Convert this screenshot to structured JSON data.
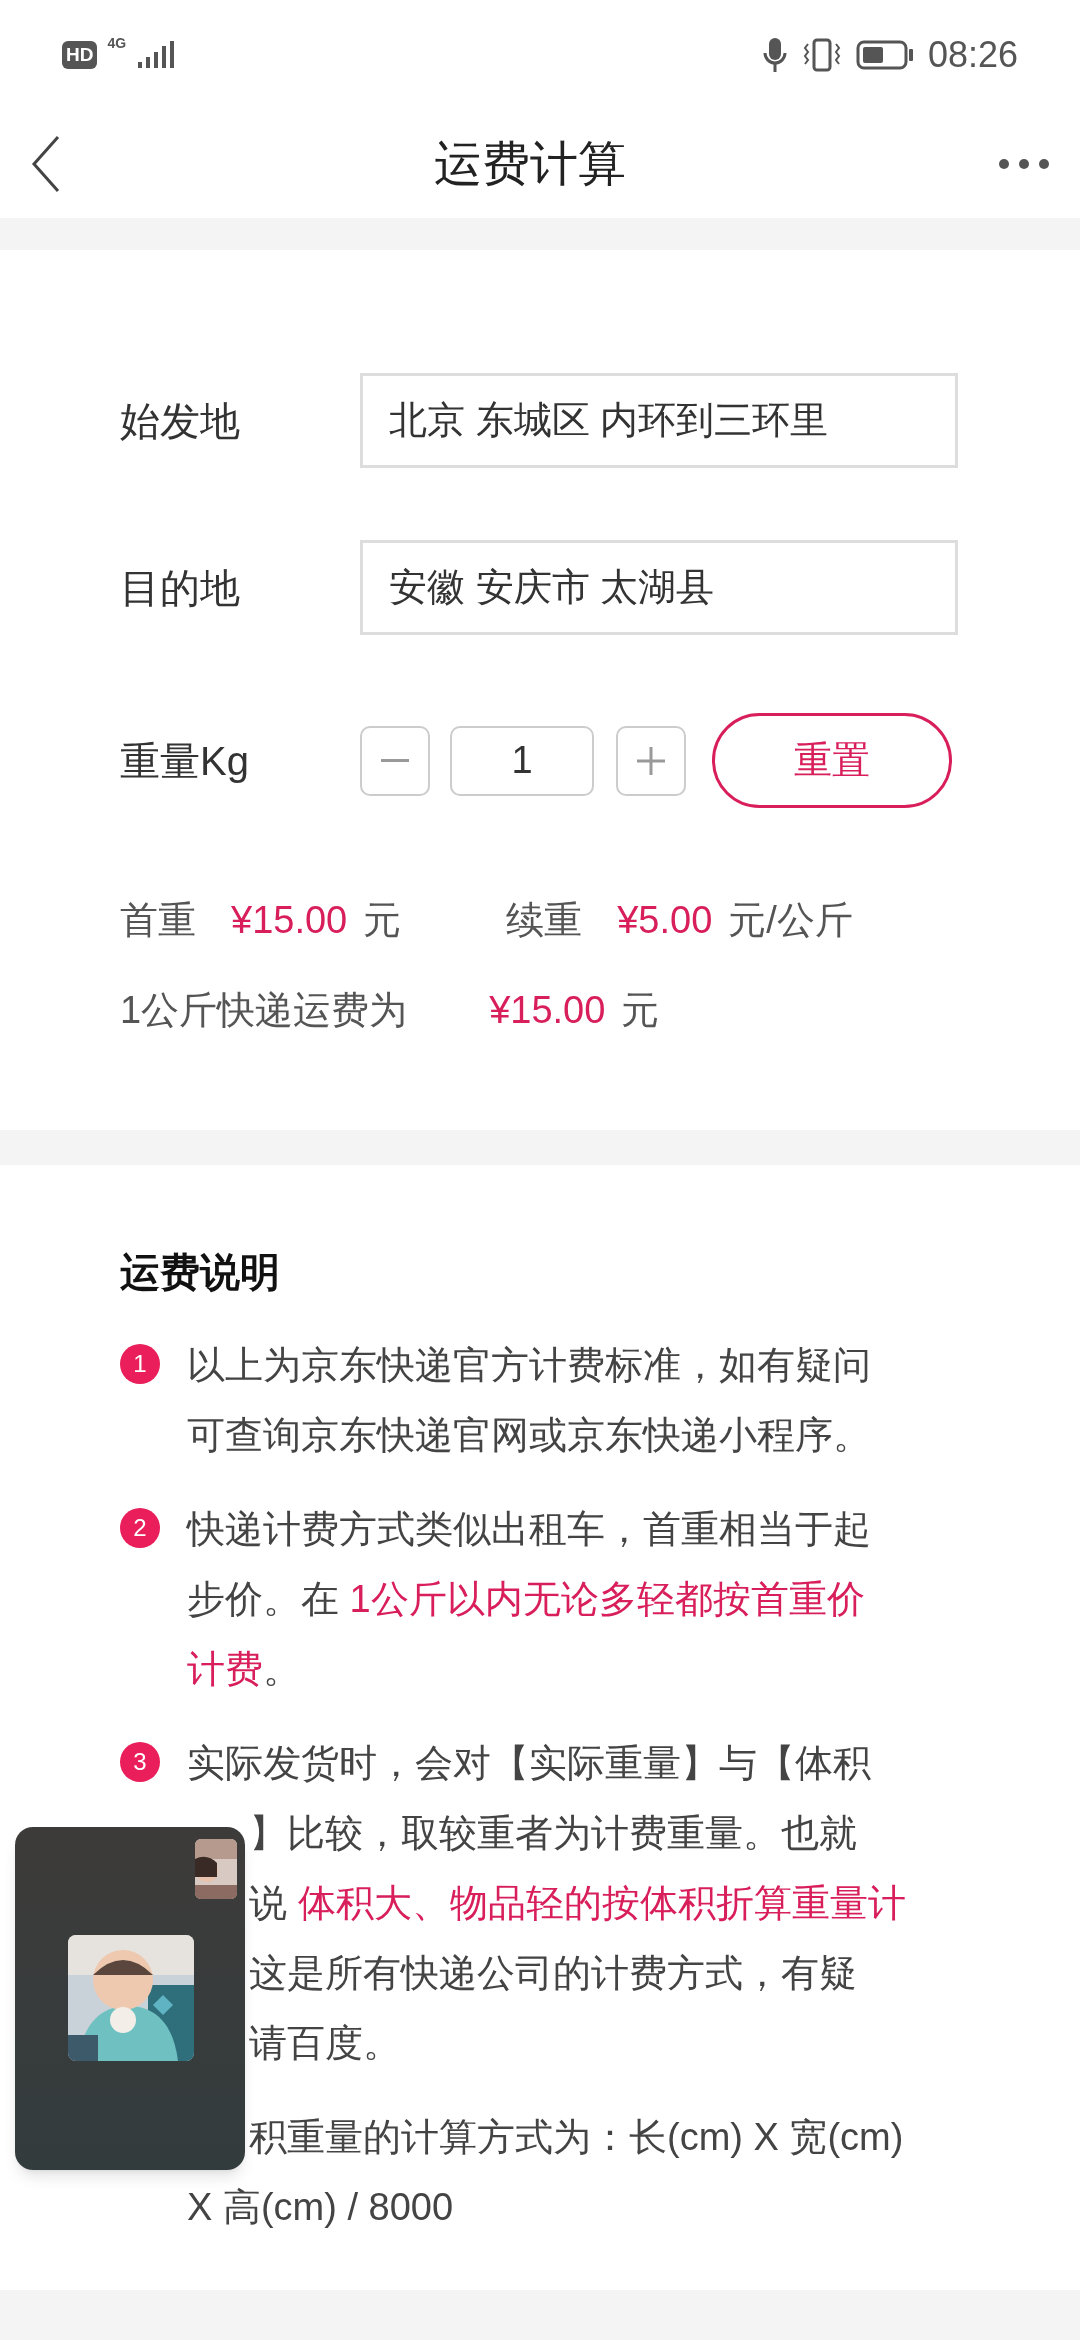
{
  "status_bar": {
    "hd": "HD",
    "network": "4G",
    "time": "08:26"
  },
  "nav": {
    "title": "运费计算"
  },
  "form": {
    "fields": [
      {
        "label": "始发地",
        "value": "北京 东城区 内环到三环里"
      },
      {
        "label": "目的地",
        "value": "安徽 安庆市 太湖县"
      }
    ],
    "weight": {
      "label": "重量Kg",
      "value": "1",
      "reset": "重置"
    },
    "prices": [
      [
        {
          "text": "首重",
          "highlight": false
        },
        {
          "text": "¥15.00",
          "highlight": true
        },
        {
          "text": "元",
          "highlight": false
        },
        {
          "text": "续重",
          "highlight": false
        },
        {
          "text": "¥5.00",
          "highlight": true
        },
        {
          "text": "元/公斤",
          "highlight": false
        }
      ],
      [
        {
          "text": "1公斤快递运费为",
          "highlight": false
        },
        {
          "text": "¥15.00",
          "highlight": true
        },
        {
          "text": "元",
          "highlight": false
        }
      ]
    ]
  },
  "notes": {
    "title": "运费说明",
    "items": [
      {
        "number": "1",
        "lines": [
          {
            "parts": [
              {
                "text": "以上为京东快递官方计费标准，如有疑问",
                "highlight": false
              }
            ]
          },
          {
            "parts": [
              {
                "text": "可查询京东快递官网或京东快递小程序。",
                "highlight": false
              }
            ]
          }
        ]
      },
      {
        "number": "2",
        "lines": [
          {
            "parts": [
              {
                "text": "快递计费方式类似出租车，首重相当于起",
                "highlight": false
              }
            ]
          },
          {
            "parts": [
              {
                "text": "步价。在 ",
                "highlight": false
              },
              {
                "text": "1公斤以内无论多轻都按首重价",
                "highlight": true
              }
            ]
          },
          {
            "parts": [
              {
                "text": "计费",
                "highlight": true
              },
              {
                "text": "。",
                "highlight": false
              }
            ]
          }
        ]
      },
      {
        "number": "3",
        "lines": [
          {
            "parts": [
              {
                "text": "实际发货时，会对【实际重量】与【体积",
                "highlight": false
              }
            ]
          },
          {
            "clipped": true,
            "parts": [
              {
                "text": "】比较，取较重者为计费重量。也就",
                "highlight": false
              }
            ]
          },
          {
            "clipped": true,
            "parts": [
              {
                "text": "说 ",
                "highlight": false
              },
              {
                "text": "体积大、物品轻的按体积折算重量计",
                "highlight": true
              }
            ]
          },
          {
            "clipped": true,
            "parts": [
              {
                "text": "这是所有快递公司的计费方式，有疑",
                "highlight": false
              }
            ]
          },
          {
            "clipped": true,
            "parts": [
              {
                "text": "请百度。",
                "highlight": false
              }
            ]
          }
        ]
      },
      {
        "lines": [
          {
            "clipped": true,
            "parts": [
              {
                "text": "积重量的计算方式为：长(cm) X 宽(cm)",
                "highlight": false
              }
            ]
          },
          {
            "parts": [
              {
                "text": "X 高(cm) / 8000",
                "highlight": false
              }
            ]
          }
        ]
      }
    ]
  }
}
